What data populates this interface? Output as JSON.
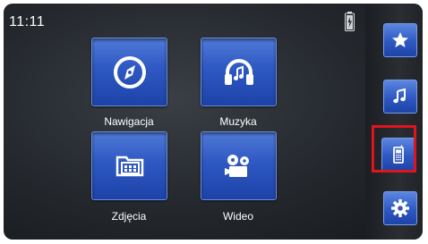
{
  "status": {
    "clock": "11:11"
  },
  "tiles": [
    {
      "label": "Nawigacja",
      "icon": "compass-icon"
    },
    {
      "label": "Muzyka",
      "icon": "headphones-icon"
    },
    {
      "label": "Zdjęcia",
      "icon": "photos-icon"
    },
    {
      "label": "Wideo",
      "icon": "video-camera-icon"
    }
  ],
  "sidebar": [
    {
      "icon": "star-icon"
    },
    {
      "icon": "music-note-icon"
    },
    {
      "icon": "phone-icon",
      "selected": true
    },
    {
      "icon": "gear-icon"
    }
  ],
  "colors": {
    "tile": "#2e58c2",
    "highlight": "#e0141e"
  }
}
